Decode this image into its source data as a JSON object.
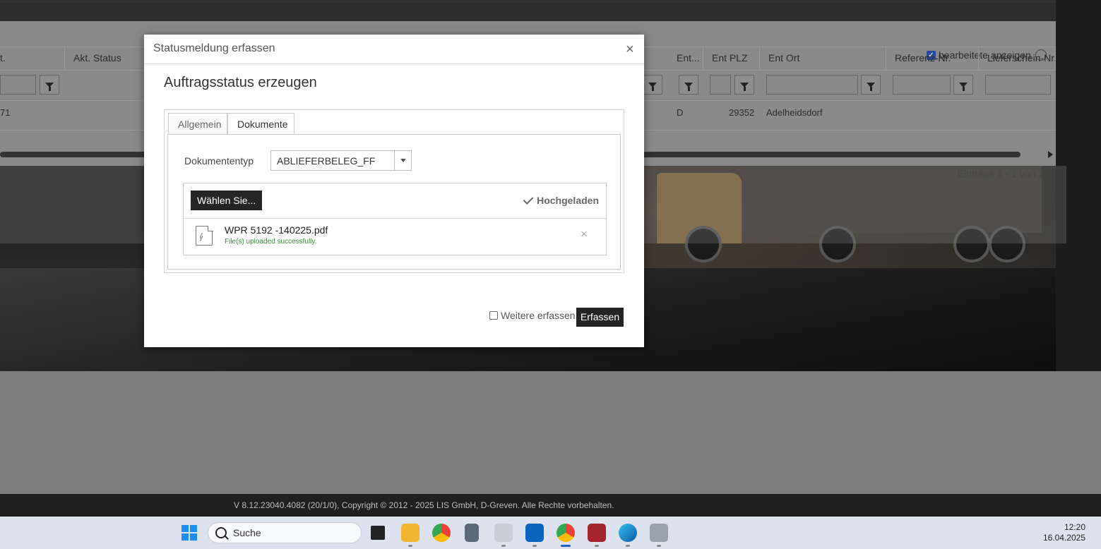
{
  "background_grid": {
    "show_edited_label": "bearbeitete anzeigen",
    "show_edited_checked": true,
    "columns": [
      {
        "label": "t."
      },
      {
        "label": "Akt. Status"
      },
      {
        "label": "Ent..."
      },
      {
        "label": "Ent PLZ"
      },
      {
        "label": "Ent Ort"
      },
      {
        "label": "Referenz-Nr."
      },
      {
        "label": "Lieferschein-Nr."
      }
    ],
    "row": {
      "c0": "71",
      "ent": "D",
      "plz": "29352",
      "ort": "Adelheidsdorf"
    },
    "entries_text": "Einträge 1 - 1 von 1"
  },
  "modal": {
    "title": "Statusmeldung erfassen",
    "close_label": "×",
    "section_title": "Auftragsstatus erzeugen",
    "tabs": [
      {
        "label": "Allgemein"
      },
      {
        "label": "Dokumente"
      }
    ],
    "active_tab": "Dokumente",
    "doctype_label": "Dokumententyp",
    "doctype_value": "ABLIEFERBELEG_FF",
    "choose_button": "Wählen Sie...",
    "uploaded_label": "Hochgeladen",
    "file": {
      "name": "WPR 5192 -140225.pdf",
      "status": "File(s) uploaded successfully.",
      "remove_label": "×"
    },
    "more_capture_label": "Weitere erfassen",
    "more_capture_checked": false,
    "capture_button": "Erfassen"
  },
  "footer": {
    "text": "V 8.12.23040.4082 (20/1/0), Copyright © 2012 - 2025 LIS GmbH, D-Greven. Alle Rechte vorbehalten."
  },
  "taskbar": {
    "search_label": "Suche",
    "time": "12:20",
    "date": "16.04.2025",
    "apps": [
      "task-view",
      "file-explorer",
      "chrome",
      "calculator",
      "scanner",
      "outlook",
      "chrome-profile",
      "access",
      "edge",
      "printer"
    ]
  },
  "colors": {
    "accent_dark": "#252525",
    "success_green": "#3a8a3a"
  }
}
